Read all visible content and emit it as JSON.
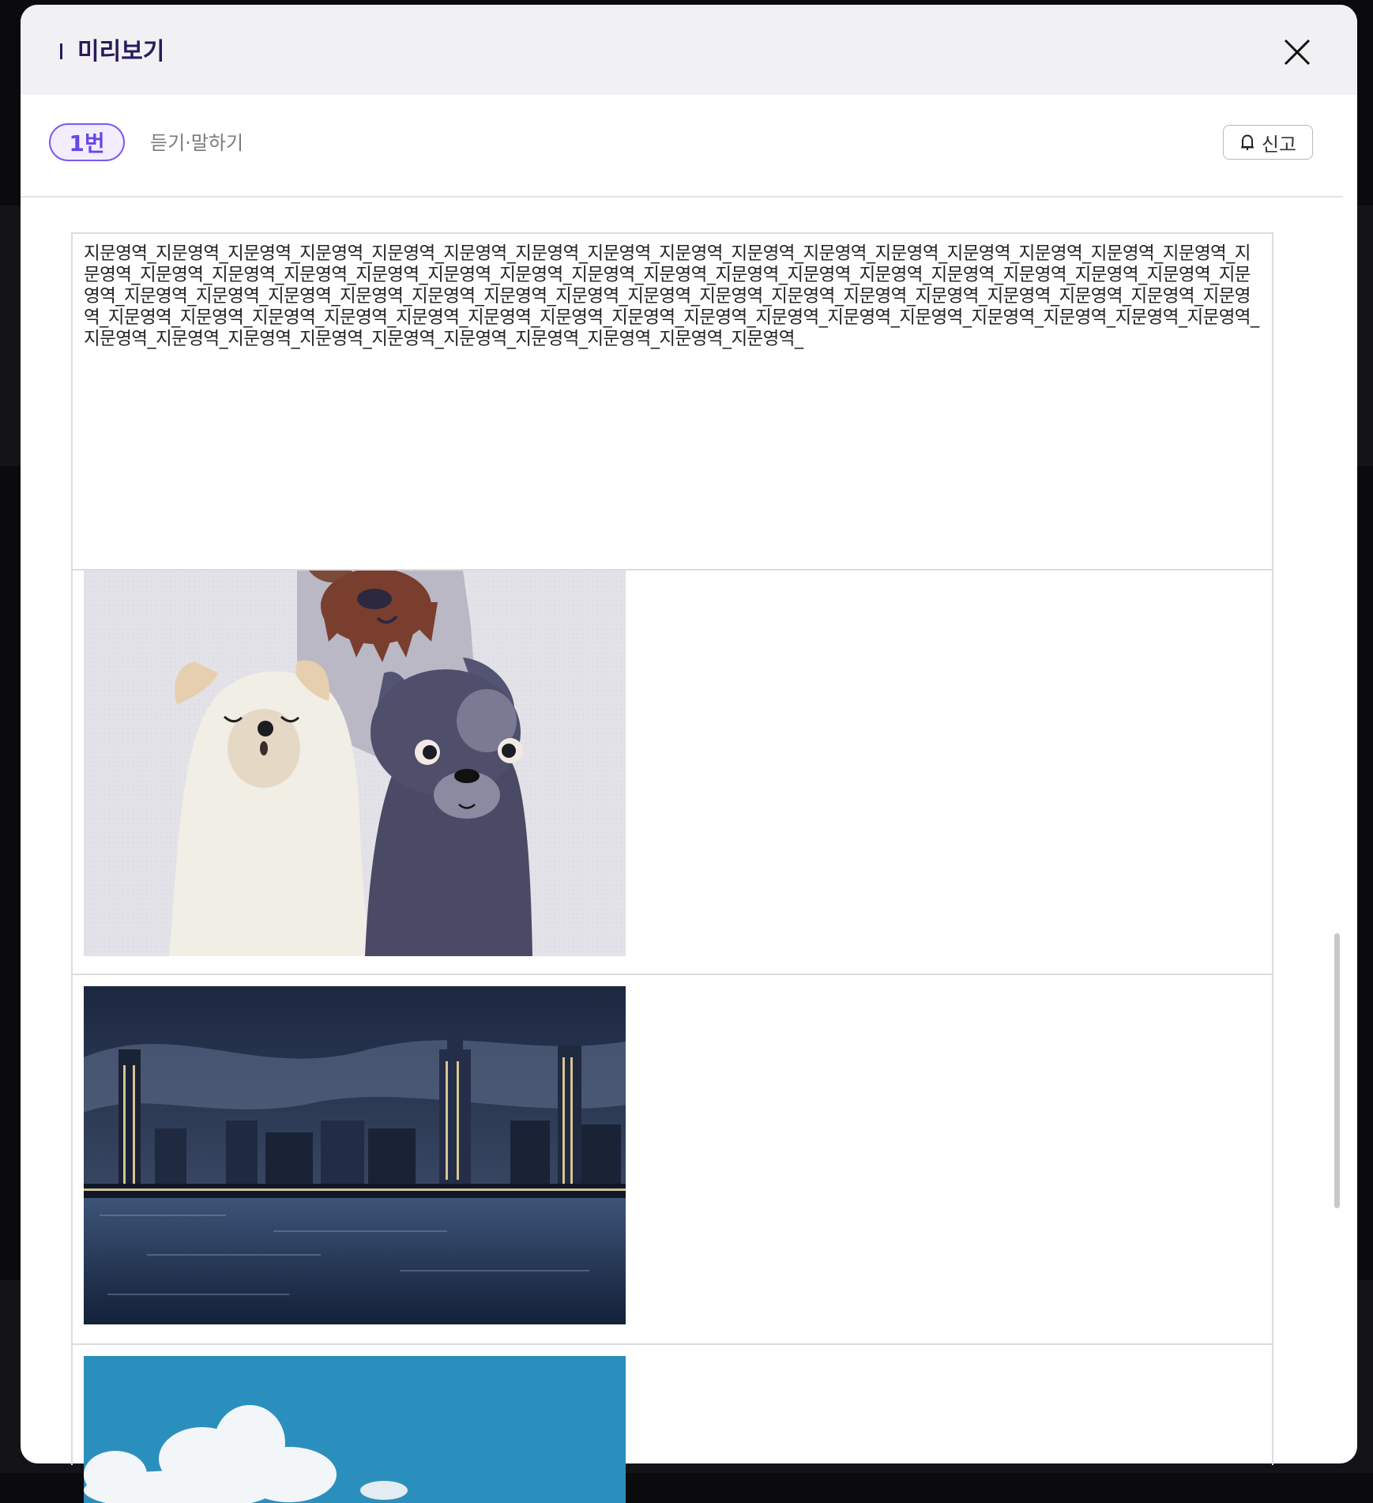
{
  "modal": {
    "title": "미리보기"
  },
  "question": {
    "number_label": "1번",
    "type_label": "듣기·말하기",
    "report_label": "신고"
  },
  "passage": {
    "text": "지문영역_지문영역_지문영역_지문영역_지문영역_지문영역_지문영역_지문영역_지문영역_지문영역_지문영역_지문영역_지문영역_지문영역_지문영역_지문영역_지문영역_지문영역_지문영역_지문영역_지문영역_지문영역_지문영역_지문영역_지문영역_지문영역_지문영역_지문영역_지문영역_지문영역_지문영역_지문영역_지문영역_지문영역_지문영역_지문영역_지문영역_지문영역_지문영역_지문영역_지문영역_지문영역_지문영역_지문영역_지문영역_지문영역_지문영역_지문영역_지문영역_지문영역_지문영역_지문영역_지문영역_지문영역_지문영역_지문영역_지문영역_지문영역_지문영역_지문영역_지문영역_지문영역_지문영역_지문영역_지문영역_지문영역_지문영역_지문영역_지문영역_지문영역_지문영역_지문영역_지문영역_지문영역_지문영역_"
  },
  "images": [
    {
      "icon": "illustration-dogs-image"
    },
    {
      "icon": "night-city-skyline-image"
    },
    {
      "icon": "sky-clouds-image"
    }
  ],
  "colors": {
    "accent": "#6a45e8",
    "title": "#2a1a5e",
    "header_bg": "#f1f1f3"
  }
}
